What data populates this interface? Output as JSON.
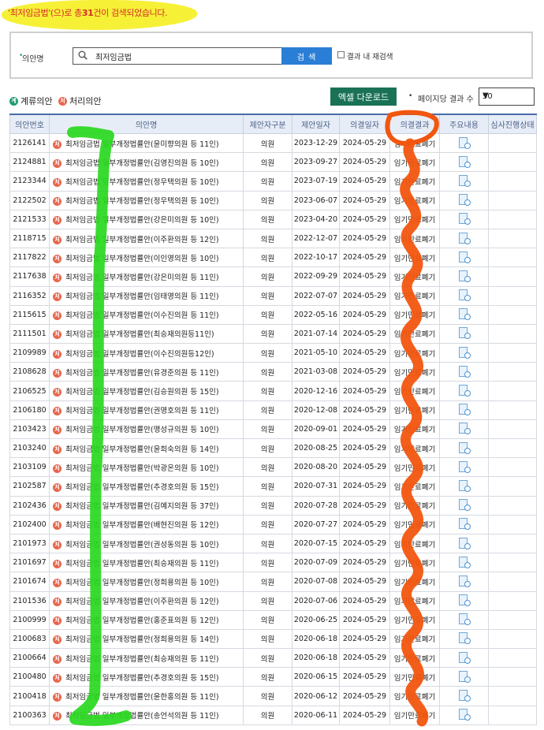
{
  "result_banner": {
    "prefix": "'최저임금법'(으)로 총",
    "count": "31",
    "suffix": "건이 검색되었습니다."
  },
  "search": {
    "label": "의안명",
    "value": "최저임금법",
    "button": "검 색",
    "within_results_label": "결과 내 재검색"
  },
  "legend": {
    "pending_badge": "계",
    "pending_label": "계류의안",
    "processed_badge": "처",
    "processed_label": "처리의안"
  },
  "toolbar": {
    "excel_button": "엑셀 다운로드",
    "per_page_label": "페이지당 결과 수",
    "per_page_value": "50"
  },
  "table": {
    "headers": [
      "의안번호",
      "의안명",
      "제안자구분",
      "제안일자",
      "의결일자",
      "의결결과",
      "주요내용",
      "심사진행상태"
    ],
    "rows": [
      [
        "2126141",
        "최저임금법 일부개정법률안(윤미향의원 등 11인)",
        "의원",
        "2023-12-29",
        "2024-05-29",
        "임기만료폐기"
      ],
      [
        "2124881",
        "최저임금법 일부개정법률안(김영진의원 등 10인)",
        "의원",
        "2023-09-27",
        "2024-05-29",
        "임기만료폐기"
      ],
      [
        "2123344",
        "최저임금법 일부개정법률안(정우택의원 등 10인)",
        "의원",
        "2023-07-19",
        "2024-05-29",
        "임기만료폐기"
      ],
      [
        "2122502",
        "최저임금법 일부개정법률안(정우택의원 등 10인)",
        "의원",
        "2023-06-07",
        "2024-05-29",
        "임기만료폐기"
      ],
      [
        "2121533",
        "최저임금법 일부개정법률안(강은미의원 등 10인)",
        "의원",
        "2023-04-20",
        "2024-05-29",
        "임기만료폐기"
      ],
      [
        "2118715",
        "최저임금법 일부개정법률안(이주환의원 등 12인)",
        "의원",
        "2022-12-07",
        "2024-05-29",
        "임기만료폐기"
      ],
      [
        "2117822",
        "최저임금법 일부개정법률안(이인영의원 등 10인)",
        "의원",
        "2022-10-17",
        "2024-05-29",
        "임기만료폐기"
      ],
      [
        "2117638",
        "최저임금법 일부개정법률안(강은미의원 등 11인)",
        "의원",
        "2022-09-29",
        "2024-05-29",
        "임기만료폐기"
      ],
      [
        "2116352",
        "최저임금법 일부개정법률안(임태영의원 등 11인)",
        "의원",
        "2022-07-07",
        "2024-05-29",
        "임기만료폐기"
      ],
      [
        "2115615",
        "최저임금법 일부개정법률안(이수진의원 등 11인)",
        "의원",
        "2022-05-16",
        "2024-05-29",
        "임기만료폐기"
      ],
      [
        "2111501",
        "최저임금법 일부개정법률안(최승재의원등11인)",
        "의원",
        "2021-07-14",
        "2024-05-29",
        "임기만료폐기"
      ],
      [
        "2109989",
        "최저임금법 일부개정법률안(이수진의원등12인)",
        "의원",
        "2021-05-10",
        "2024-05-29",
        "임기만료폐기"
      ],
      [
        "2108628",
        "최저임금법 일부개정법률안(유경준의원 등 11인)",
        "의원",
        "2021-03-08",
        "2024-05-29",
        "임기만료폐기"
      ],
      [
        "2106525",
        "최저임금법 일부개정법률안(김승원의원 등 15인)",
        "의원",
        "2020-12-16",
        "2024-05-29",
        "임기만료폐기"
      ],
      [
        "2106180",
        "최저임금법 일부개정법률안(권명호의원 등 11인)",
        "의원",
        "2020-12-08",
        "2024-05-29",
        "임기만료폐기"
      ],
      [
        "2103423",
        "최저임금법 일부개정법률안(맹성규의원 등 10인)",
        "의원",
        "2020-09-01",
        "2024-05-29",
        "임기만료폐기"
      ],
      [
        "2103240",
        "최저임금법 일부개정법률안(윤희숙의원 등 14인)",
        "의원",
        "2020-08-25",
        "2024-05-29",
        "임기만료폐기"
      ],
      [
        "2103109",
        "최저임금법 일부개정법률안(박광온의원 등 10인)",
        "의원",
        "2020-08-20",
        "2024-05-29",
        "임기만료폐기"
      ],
      [
        "2102587",
        "최저임금법 일부개정법률안(추경호의원 등 15인)",
        "의원",
        "2020-07-31",
        "2024-05-29",
        "임기만료폐기"
      ],
      [
        "2102436",
        "최저임금법 일부개정법률안(김예지의원 등 37인)",
        "의원",
        "2020-07-28",
        "2024-05-29",
        "임기만료폐기"
      ],
      [
        "2102400",
        "최저임금법 일부개정법률안(배현진의원 등 12인)",
        "의원",
        "2020-07-27",
        "2024-05-29",
        "임기만료폐기"
      ],
      [
        "2101973",
        "최저임금법 일부개정법률안(권성동의원 등 10인)",
        "의원",
        "2020-07-15",
        "2024-05-29",
        "임기만료폐기"
      ],
      [
        "2101697",
        "최저임금법 일부개정법률안(최승재의원 등 11인)",
        "의원",
        "2020-07-09",
        "2024-05-29",
        "임기만료폐기"
      ],
      [
        "2101674",
        "최저임금법 일부개정법률안(정희용의원 등 10인)",
        "의원",
        "2020-07-08",
        "2024-05-29",
        "임기만료폐기"
      ],
      [
        "2101536",
        "최저임금법 일부개정법률안(이주환의원 등 12인)",
        "의원",
        "2020-07-06",
        "2024-05-29",
        "임기만료폐기"
      ],
      [
        "2100999",
        "최저임금법 일부개정법률안(홍준표의원 등 12인)",
        "의원",
        "2020-06-25",
        "2024-05-29",
        "임기만료폐기"
      ],
      [
        "2100683",
        "최저임금법 일부개정법률안(정희용의원 등 14인)",
        "의원",
        "2020-06-18",
        "2024-05-29",
        "임기만료폐기"
      ],
      [
        "2100664",
        "최저임금법 일부개정법률안(최승재의원 등 11인)",
        "의원",
        "2020-06-18",
        "2024-05-29",
        "임기만료폐기"
      ],
      [
        "2100480",
        "최저임금법 일부개정법률안(추경호의원 등 15인)",
        "의원",
        "2020-06-15",
        "2024-05-29",
        "임기만료폐기"
      ],
      [
        "2100418",
        "최저임금법 일부개정법률안(윤한홍의원 등 11인)",
        "의원",
        "2020-06-12",
        "2024-05-29",
        "임기만료폐기"
      ],
      [
        "2100363",
        "최저임금법 일부개정법률안(송언석의원 등 11인)",
        "의원",
        "2020-06-11",
        "2024-05-29",
        "임기만료폐기"
      ]
    ]
  },
  "colors": {
    "highlight_yellow": "#f5ee14",
    "marker_green": "#29d81e",
    "marker_orange": "#f2560f",
    "search_button": "#2b7ed6",
    "excel_button": "#1a7256"
  }
}
